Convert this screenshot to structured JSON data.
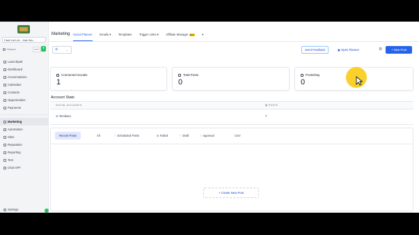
{
  "extensions": [
    {
      "name": "ext-green-icon",
      "color": "#22c55e"
    },
    {
      "name": "ext-orange-icon",
      "color": "#f97316"
    }
  ],
  "sidebar": {
    "account": "Facil Ltd Ltd. - Hair Wo...",
    "search_placeholder": "Search",
    "search_shortcut": "ctrl K",
    "items": [
      {
        "label": "Launchpad"
      },
      {
        "label": "Dashboard"
      },
      {
        "label": "Conversations"
      },
      {
        "label": "Calendars"
      },
      {
        "label": "Contacts"
      },
      {
        "label": "Opportunities"
      },
      {
        "label": "Payments"
      }
    ],
    "items2": [
      {
        "label": "Marketing",
        "active": true
      },
      {
        "label": "Automation"
      },
      {
        "label": "Sites"
      },
      {
        "label": "Reputation"
      },
      {
        "label": "Reporting"
      },
      {
        "label": "Test"
      },
      {
        "label": "Chat GPT"
      }
    ],
    "settings": "Settings"
  },
  "header": {
    "title": "Marketing",
    "tabs": [
      {
        "label": "Social Planner",
        "active": true
      },
      {
        "label": "Emails ▾"
      },
      {
        "label": "Templates"
      },
      {
        "label": "Trigger Links ▾"
      },
      {
        "label": "Affiliate Manager",
        "badge": "New"
      },
      {
        "label": "▾"
      }
    ]
  },
  "toolbar": {
    "filter_caret": "⌄",
    "send_feedback": "Send Feedback",
    "open_planner": "Open Planner",
    "new_post": "+ New Post"
  },
  "stats": [
    {
      "label": "Connected Socials",
      "value": "1"
    },
    {
      "label": "Total Posts",
      "value": "0"
    },
    {
      "label": "Posts/Day",
      "value": "0"
    }
  ],
  "account_stats": {
    "title": "Account Stats",
    "headers": [
      "SOCIAL ACCOUNTS",
      "POSTS"
    ],
    "rows": [
      {
        "account": "Temikaro",
        "posts": "7"
      }
    ]
  },
  "posts": {
    "filters": [
      {
        "label": "Recent Posts",
        "active": true
      },
      {
        "label": "All"
      },
      {
        "label": "Scheduled Posts"
      },
      {
        "label": "Failed"
      },
      {
        "label": "Draft"
      },
      {
        "label": "Approval"
      },
      {
        "label": "CSV"
      }
    ],
    "create_label": "+ Create New Post"
  }
}
